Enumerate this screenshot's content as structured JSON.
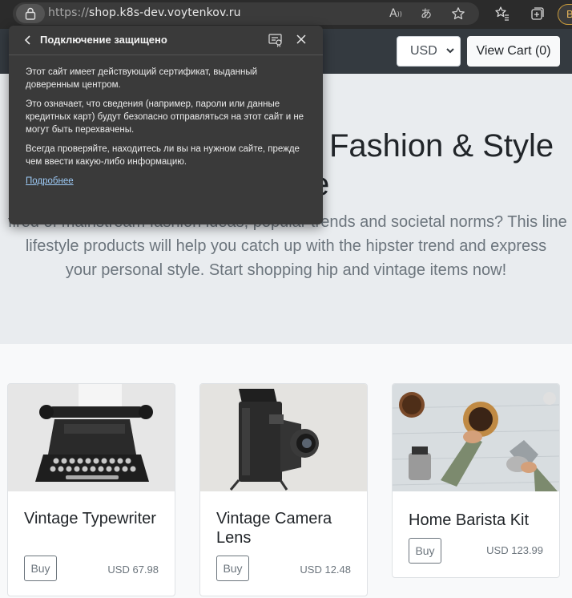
{
  "browser": {
    "url_protocol": "https://",
    "url_host": "shop.k8s-dev.voytenkov.ru",
    "profile_initial": "B"
  },
  "security_popup": {
    "title": "Подключение защищено",
    "paragraph1": "Этот сайт имеет действующий сертификат, выданный доверенным центром.",
    "paragraph2": "Это означает, что сведения (например, пароли или данные кредитных карт) будут безопасно отправляться на этот сайт и не могут быть перехвачены.",
    "paragraph3": "Всегда проверяйте, находитесь ли вы на нужном сайте, прежде чем ввести какую-либо информацию.",
    "link": "Подробнее"
  },
  "header": {
    "currency": "USD",
    "view_cart": "View Cart (0)"
  },
  "hero": {
    "title_line1": "Fashion & Style",
    "title_line2": "e",
    "text": "lifestyle products will help you catch up with the hipster trend and express your personal style. Start shopping hip and vintage items now!",
    "text_partial": "fired of mainstream fashion ideas, popular trends and societal norms? This line of"
  },
  "products": [
    {
      "name": "Vintage Typewriter",
      "buy": "Buy",
      "price": "USD 67.98"
    },
    {
      "name": "Vintage Camera Lens",
      "buy": "Buy",
      "price": "USD 12.48"
    },
    {
      "name": "Home Barista Kit",
      "buy": "Buy",
      "price": "USD 123.99"
    }
  ]
}
